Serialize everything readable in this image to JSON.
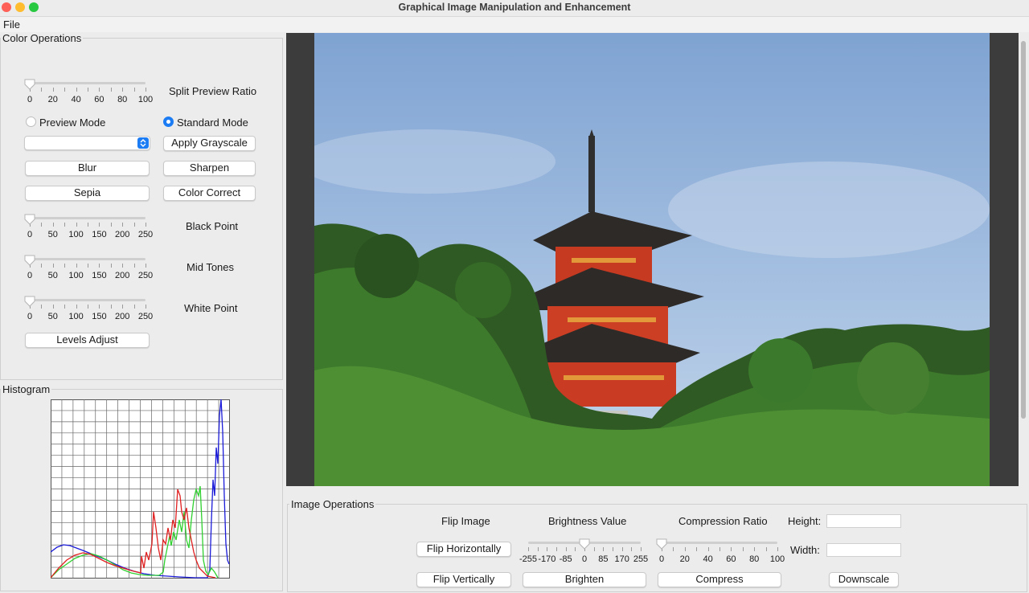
{
  "window": {
    "title": "Graphical Image Manipulation and Enhancement",
    "controls": [
      "close-icon",
      "minimize-icon",
      "zoom-icon"
    ],
    "control_colors": [
      "#fe5f57",
      "#febc2e",
      "#28c840"
    ]
  },
  "menu": {
    "file": "File"
  },
  "color_ops": {
    "title": "Color Operations",
    "split_slider": {
      "ticks": [
        "0",
        "20",
        "40",
        "60",
        "80",
        "100"
      ],
      "value": 0,
      "label": "Split Preview Ratio"
    },
    "preview_mode": {
      "label": "Preview Mode",
      "selected": false
    },
    "standard_mode": {
      "label": "Standard Mode",
      "selected": true
    },
    "combo": {
      "value": ""
    },
    "buttons": {
      "grayscale": "Apply Grayscale",
      "blur": "Blur",
      "sharpen": "Sharpen",
      "sepia": "Sepia",
      "color_correct": "Color Correct",
      "levels": "Levels Adjust"
    },
    "black_point": {
      "ticks": [
        "0",
        "50",
        "100",
        "150",
        "200",
        "250"
      ],
      "value": 0,
      "label": "Black Point"
    },
    "mid_tones": {
      "ticks": [
        "0",
        "50",
        "100",
        "150",
        "200",
        "250"
      ],
      "value": 0,
      "label": "Mid Tones"
    },
    "white_point": {
      "ticks": [
        "0",
        "50",
        "100",
        "150",
        "200",
        "250"
      ],
      "value": 0,
      "label": "White Point"
    }
  },
  "histogram": {
    "title": "Histogram",
    "colors": {
      "red": "#e02020",
      "green": "#30d030",
      "blue": "#1a1ad8"
    }
  },
  "image_ops": {
    "title": "Image Operations",
    "flip_label": "Flip Image",
    "flip_h": "Flip Horizontally",
    "flip_v": "Flip Vertically",
    "brightness": {
      "label": "Brightness Value",
      "ticks": [
        "-255",
        "-170",
        "-85",
        "0",
        "85",
        "170",
        "255"
      ],
      "value": 0,
      "button": "Brighten"
    },
    "compression": {
      "label": "Compression Ratio",
      "ticks": [
        "0",
        "20",
        "40",
        "60",
        "80",
        "100"
      ],
      "value": 0,
      "button": "Compress"
    },
    "height_label": "Height:",
    "width_label": "Width:",
    "height_value": "",
    "width_value": "",
    "downscale": "Downscale"
  },
  "accent": "#1c7cf4"
}
